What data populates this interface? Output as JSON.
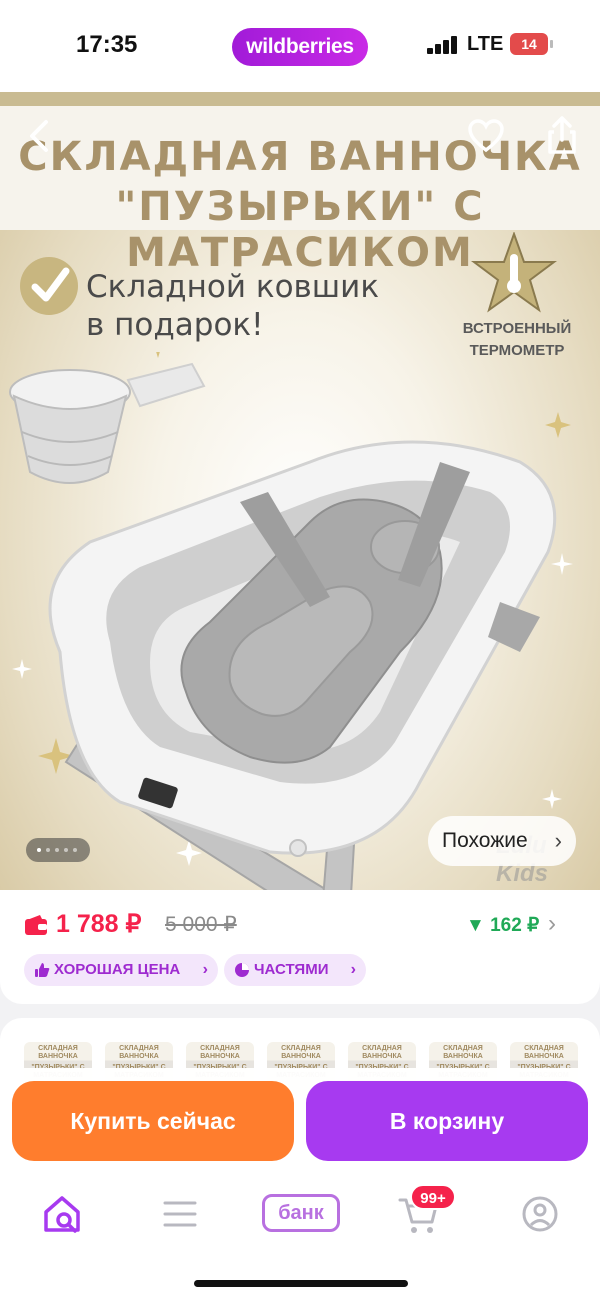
{
  "status_bar": {
    "time": "17:35",
    "brand": "wildberries",
    "network": "LTE",
    "battery": "14"
  },
  "hero": {
    "banner_line1": "СКЛАДНАЯ ВАННОЧКА",
    "banner_line2": "\"ПУЗЫРЬКИ\" С МАТРАСИКОМ",
    "gift_line1": "Складной ковшик",
    "gift_line2": "в подарок!",
    "thermo_line1": "ВСТРОЕННЫЙ",
    "thermo_line2": "ТЕРМОМЕТР",
    "watermark": "Lulu Kids",
    "similar_label": "Похожие",
    "gallery_dots": 5,
    "gallery_active": 1
  },
  "price": {
    "current": "1 788 ₽",
    "old": "5 000 ₽",
    "discount": "162 ₽",
    "badges": [
      {
        "label": "ХОРОШАЯ ЦЕНА",
        "icon": "thumbs-up-icon"
      },
      {
        "label": "ЧАСТЯМИ",
        "icon": "pie-chart-icon"
      }
    ]
  },
  "thumbnails": {
    "caption_line1": "СКЛАДНАЯ ВАННОЧКА",
    "caption_line2": "\"ПУЗЫРЬКИ\" С МАТРАСИКОМ"
  },
  "actions": {
    "buy_now": "Купить сейчас",
    "add_to_cart": "В корзину"
  },
  "tabbar": {
    "bank": "банк",
    "cart_badge": "99+"
  },
  "colors": {
    "brand": "#a11bd8",
    "price": "#f5224b",
    "discount": "#20a957",
    "buy_now": "#ff7d2d",
    "add_to_cart": "#a73af0",
    "banner_text": "#a8926a"
  }
}
